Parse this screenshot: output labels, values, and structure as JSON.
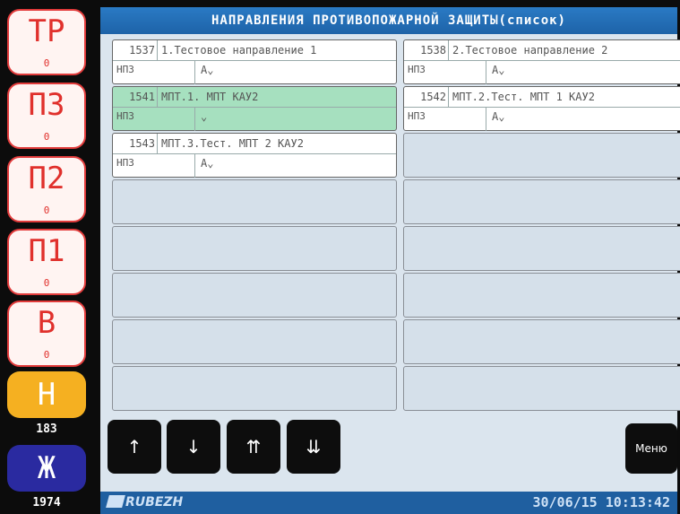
{
  "sidebar": {
    "items": [
      {
        "letter": "ТР",
        "count": "0"
      },
      {
        "letter": "ПЗ",
        "count": "0"
      },
      {
        "letter": "П2",
        "count": "0"
      },
      {
        "letter": "П1",
        "count": "0"
      },
      {
        "letter": "В",
        "count": "0"
      },
      {
        "letter": "Н",
        "count": "183"
      },
      {
        "letter": "Ж",
        "count": "1974"
      }
    ]
  },
  "header": {
    "title": "НАПРАВЛЕНИЯ ПРОТИВОПОЖАРНОЙ ЗАЩИТЫ(список)"
  },
  "directions": [
    {
      "number": "1537",
      "name": "1.Тестовое направление 1",
      "type": "НПЗ",
      "mode": "A⌄"
    },
    {
      "number": "1538",
      "name": "2.Тестовое направление 2",
      "type": "НПЗ",
      "mode": "A⌄"
    },
    {
      "number": "1541",
      "name": "МПТ.1. МПТ КАУ2",
      "type": "НПЗ",
      "mode": "⌄"
    },
    {
      "number": "1542",
      "name": "МПТ.2.Тест. МПТ 1 КАУ2",
      "type": "НПЗ",
      "mode": "A⌄"
    },
    {
      "number": "1543",
      "name": "МПТ.3.Тест. МПТ 2 КАУ2",
      "type": "НПЗ",
      "mode": "A⌄"
    }
  ],
  "nav": {
    "up": "↑",
    "down": "↓",
    "page_up": "⇈",
    "page_down": "⇊",
    "menu": "Меню"
  },
  "footer": {
    "logo": "RUBEZH",
    "datetime": "30/06/15 10:13:42"
  },
  "colors": {
    "accent": "#1f5fa0",
    "alarm": "#e23b3b",
    "active_row": "#a6e0bf",
    "warning": "#f5b021",
    "status_blue": "#2a2aa0"
  }
}
